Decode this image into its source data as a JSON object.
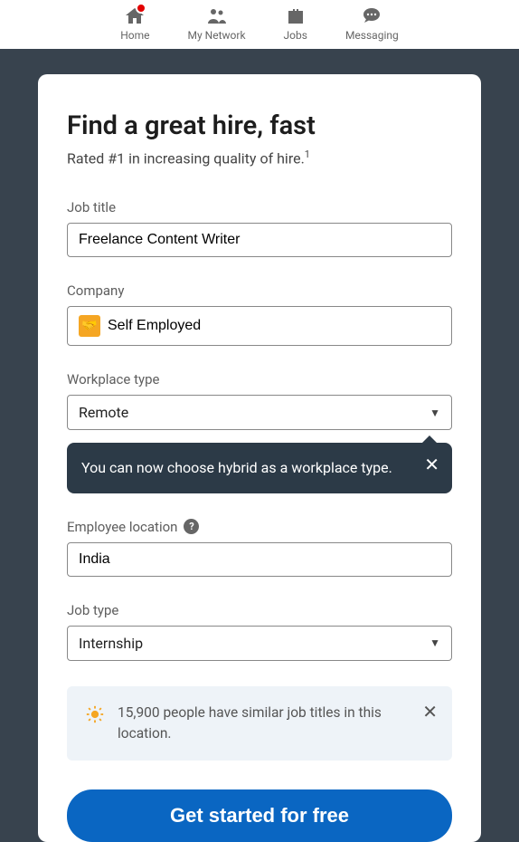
{
  "nav": {
    "home": "Home",
    "network": "My Network",
    "jobs": "Jobs",
    "messaging": "Messaging"
  },
  "card": {
    "heading": "Find a great hire, fast",
    "subtitle": "Rated #1 in increasing quality of hire.",
    "footnote": "1"
  },
  "fields": {
    "jobTitle": {
      "label": "Job title",
      "value": "Freelance Content Writer"
    },
    "company": {
      "label": "Company",
      "value": "Self Employed"
    },
    "workplace": {
      "label": "Workplace type",
      "value": "Remote"
    },
    "location": {
      "label": "Employee location",
      "value": "India"
    },
    "jobType": {
      "label": "Job type",
      "value": "Internship"
    }
  },
  "tooltip": {
    "text": "You can now choose hybrid as a workplace type."
  },
  "infoBanner": {
    "text": "15,900 people have similar job titles in this location."
  },
  "cta": {
    "label": "Get started for free"
  }
}
